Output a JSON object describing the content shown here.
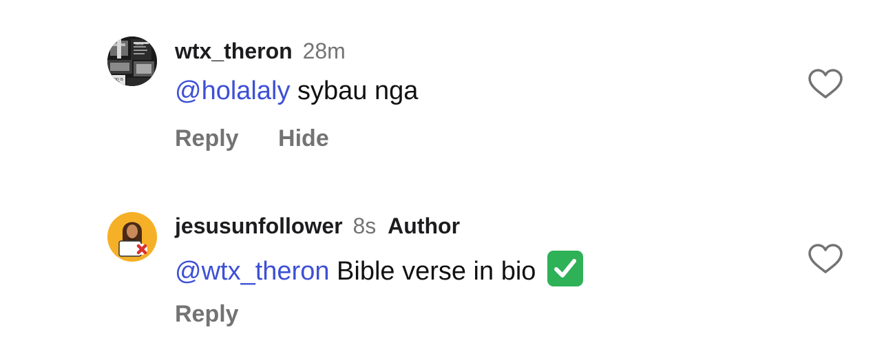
{
  "comments": [
    {
      "username": "wtx_theron",
      "time": "28m",
      "mention": "@holalaly",
      "text": " sybau nga",
      "actions": [
        "Reply",
        "Hide"
      ],
      "avatar_text": [
        "FAITH",
        "GOD IS",
        "LOVE"
      ],
      "avatar_color": "#1a1a1a",
      "like_icon": "heart-outline-icon"
    },
    {
      "username": "jesusunfollower",
      "time": "8s",
      "badge": "Author",
      "mention": "@wtx_theron",
      "text": " Bible verse in bio ",
      "emoji": "check-mark-button-icon",
      "actions": [
        "Reply"
      ],
      "avatar_color": "#f5b027",
      "like_icon": "heart-outline-icon"
    }
  ],
  "colors": {
    "mention": "#3d50d6",
    "secondary": "#737373",
    "primary": "#1c1c1e",
    "check_green": "#2eb157"
  }
}
